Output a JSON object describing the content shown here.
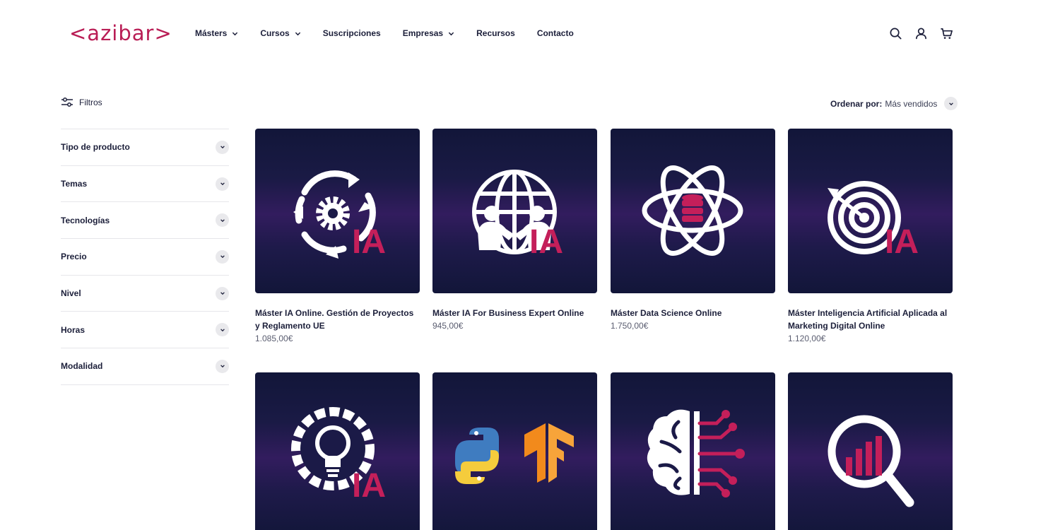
{
  "brand": {
    "logo_text": "<azibar>",
    "accent_color": "#b91d55",
    "navy_color": "#1c1f3a"
  },
  "nav": {
    "items": [
      {
        "label": "Másters",
        "has_dropdown": true
      },
      {
        "label": "Cursos",
        "has_dropdown": true
      },
      {
        "label": "Suscripciones",
        "has_dropdown": false
      },
      {
        "label": "Empresas",
        "has_dropdown": true
      },
      {
        "label": "Recursos",
        "has_dropdown": false
      },
      {
        "label": "Contacto",
        "has_dropdown": false
      }
    ],
    "icons": [
      "search-icon",
      "account-icon",
      "cart-icon"
    ]
  },
  "toolbar": {
    "filters_label": "Filtros",
    "sort_label": "Ordenar por:",
    "sort_value": "Más vendidos"
  },
  "facets": [
    {
      "label": "Tipo de producto"
    },
    {
      "label": "Temas"
    },
    {
      "label": "Tecnologías"
    },
    {
      "label": "Precio"
    },
    {
      "label": "Nivel"
    },
    {
      "label": "Horas"
    },
    {
      "label": "Modalidad"
    }
  ],
  "products": [
    {
      "title": "Máster IA Online. Gestión de Proyectos y Reglamento UE",
      "price": "1.085,00€",
      "icon": "gear-cycle-ia-icon",
      "badge": "IA"
    },
    {
      "title": "Máster IA For Business Expert Online",
      "price": "945,00€",
      "icon": "globe-handshake-ia-icon",
      "badge": "IA"
    },
    {
      "title": "Máster Data Science Online",
      "price": "1.750,00€",
      "icon": "atom-database-icon",
      "badge": ""
    },
    {
      "title": "Máster Inteligencia Artificial Aplicada al Marketing Digital Online",
      "price": "1.120,00€",
      "icon": "target-arrow-ia-icon",
      "badge": "IA"
    },
    {
      "title": "",
      "price": "",
      "icon": "lightbulb-gear-ia-icon",
      "badge": "IA"
    },
    {
      "title": "",
      "price": "",
      "icon": "python-tensorflow-icon",
      "badge": ""
    },
    {
      "title": "",
      "price": "",
      "icon": "brain-circuit-icon",
      "badge": ""
    },
    {
      "title": "",
      "price": "",
      "icon": "magnifier-chart-icon",
      "badge": ""
    }
  ]
}
